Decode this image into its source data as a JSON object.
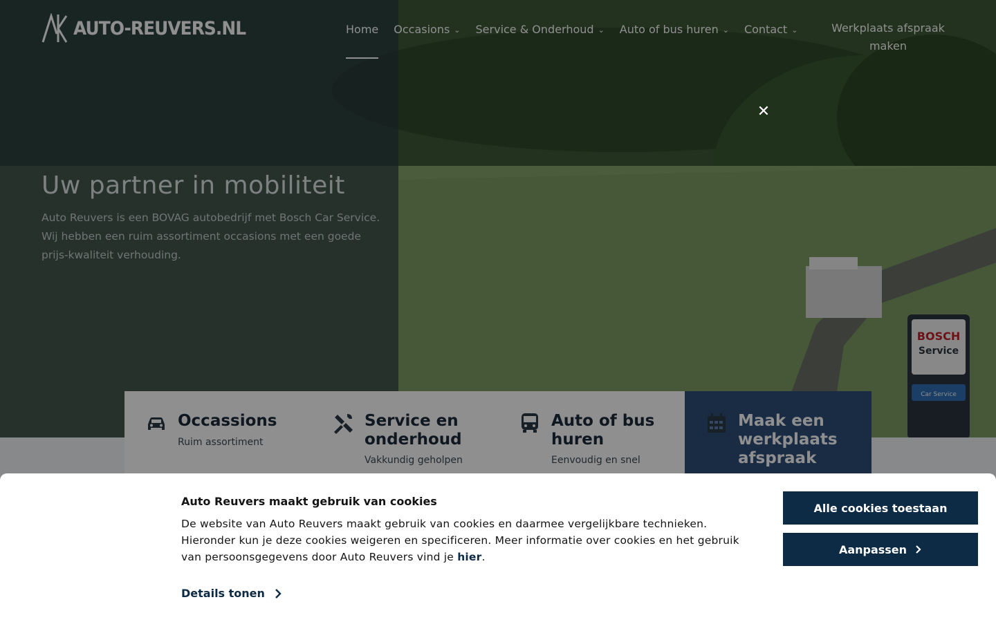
{
  "brand": {
    "logo_text": "AUTO-REUVERS.NL",
    "accent": "#0d2b45"
  },
  "nav": {
    "items": [
      {
        "label": "Home",
        "active": true
      },
      {
        "label": "Occasions",
        "has_dropdown": true
      },
      {
        "label": "Service & Onderhoud",
        "has_dropdown": true
      },
      {
        "label": "Auto of bus huren",
        "has_dropdown": true
      },
      {
        "label": "Contact",
        "has_dropdown": true
      }
    ],
    "cta_label": "Werkplaats afspraak maken"
  },
  "hero": {
    "title": "Uw partner in mobiliteit",
    "subtitle": "Auto Reuvers is een BOVAG autobedrijf met Bosch Car Service. Wij hebben een ruim assortiment occasions met een goede prijs-kwaliteit verhouding.",
    "sign_line1": "BOSCH",
    "sign_line2": "Service",
    "sign_line3": "Car Service"
  },
  "cards": [
    {
      "icon": "car-icon",
      "title": "Occassions",
      "subtitle": "Ruim assortiment"
    },
    {
      "icon": "tools-icon",
      "title": "Service en onderhoud",
      "subtitle": "Vakkundig geholpen"
    },
    {
      "icon": "bus-icon",
      "title": "Auto of bus huren",
      "subtitle": "Eenvoudig en snel"
    },
    {
      "icon": "calendar-icon",
      "title": "Maak een werkplaats afspraak",
      "subtitle": ""
    }
  ],
  "cookie": {
    "title": "Auto Reuvers maakt gebruik van cookies",
    "body": "De website van Auto Reuvers maakt gebruik van cookies en daarmee vergelijkbare technieken. Hieronder kun je deze cookies weigeren en specificeren. Meer informatie over cookies en het gebruik van persoonsgegevens door Auto Reuvers vind je",
    "link_label": "hier",
    "body_end": ".",
    "details_label": "Details tonen",
    "accept_label": "Alle cookies toestaan",
    "adjust_label": "Aanpassen"
  },
  "close_icon": "close-icon"
}
